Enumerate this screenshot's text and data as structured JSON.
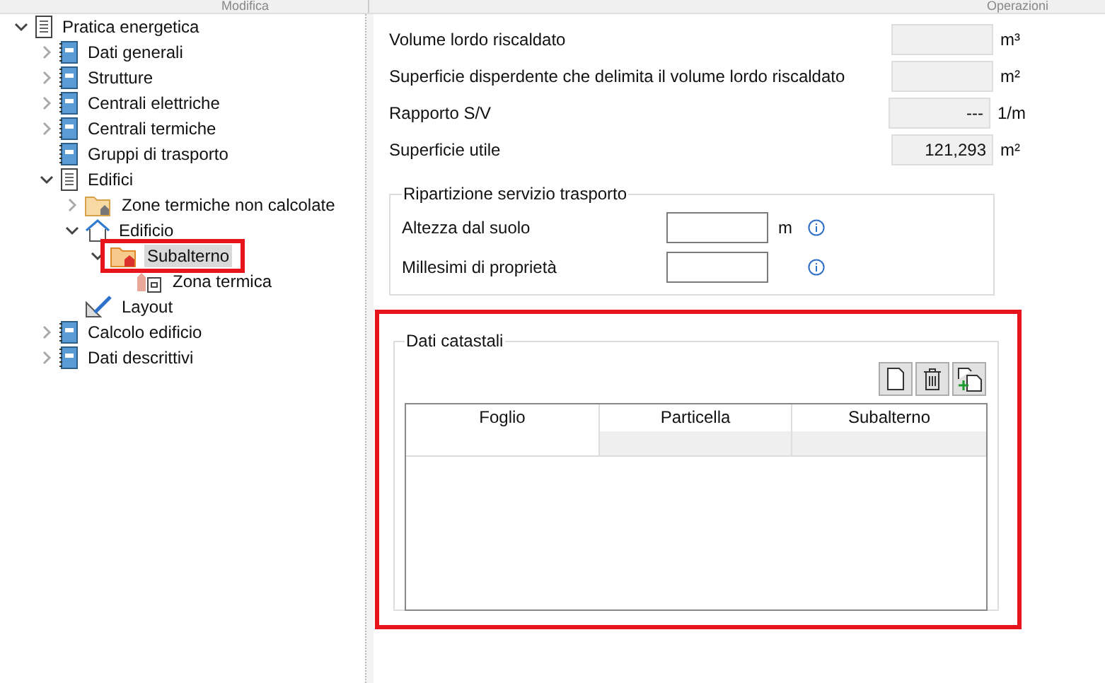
{
  "header": {
    "tabs": [
      "Modifica",
      "Operazioni"
    ]
  },
  "tree": [
    {
      "label": "Pratica energetica",
      "kind": "document",
      "expanded": true,
      "selected": false,
      "children": [
        {
          "label": "Dati generali",
          "kind": "form",
          "expanded": false,
          "selected": false
        },
        {
          "label": "Strutture",
          "kind": "form",
          "expanded": false,
          "selected": false
        },
        {
          "label": "Centrali elettriche",
          "kind": "form",
          "expanded": false,
          "selected": false
        },
        {
          "label": "Centrali termiche",
          "kind": "form",
          "expanded": false,
          "selected": false
        },
        {
          "label": "Gruppi di trasporto",
          "kind": "form",
          "selected": false
        },
        {
          "label": "Edifici",
          "kind": "document",
          "expanded": true,
          "selected": false,
          "children": [
            {
              "label": "Zone termiche non calcolate",
              "kind": "folder",
              "expanded": false,
              "selected": false
            },
            {
              "label": "Edificio",
              "kind": "house",
              "expanded": true,
              "selected": false,
              "children": [
                {
                  "label": "Subalterno",
                  "kind": "unit",
                  "expanded": true,
                  "selected": true,
                  "highlighted": true,
                  "children": [
                    {
                      "label": "Zona termica",
                      "kind": "zone",
                      "selected": false
                    }
                  ]
                }
              ]
            },
            {
              "label": "Layout",
              "kind": "layout",
              "selected": false
            }
          ]
        },
        {
          "label": "Calcolo edificio",
          "kind": "form",
          "expanded": false,
          "selected": false
        },
        {
          "label": "Dati descrittivi",
          "kind": "form",
          "expanded": false,
          "selected": false
        }
      ]
    }
  ],
  "fields": [
    {
      "label": "Volume lordo riscaldato",
      "unit": "m³"
    },
    {
      "label": "Superficie disperdente che delimita il volume lordo riscaldato",
      "unit": "m²"
    },
    {
      "label": "Rapporto S/V",
      "value": "---",
      "unit": "1/m"
    },
    {
      "label": "Superficie utile",
      "value": "121,293",
      "unit": "m²"
    }
  ],
  "transport": {
    "title": "Ripartizione servizio trasporto",
    "rows": [
      {
        "label": "Altezza dal suolo",
        "unit": "m"
      },
      {
        "label": "Millesimi di proprietà"
      }
    ]
  },
  "cadastral": {
    "title": "Dati catastali",
    "highlighted": true,
    "columns": [
      "Foglio",
      "Particella",
      "Subalterno"
    ]
  }
}
